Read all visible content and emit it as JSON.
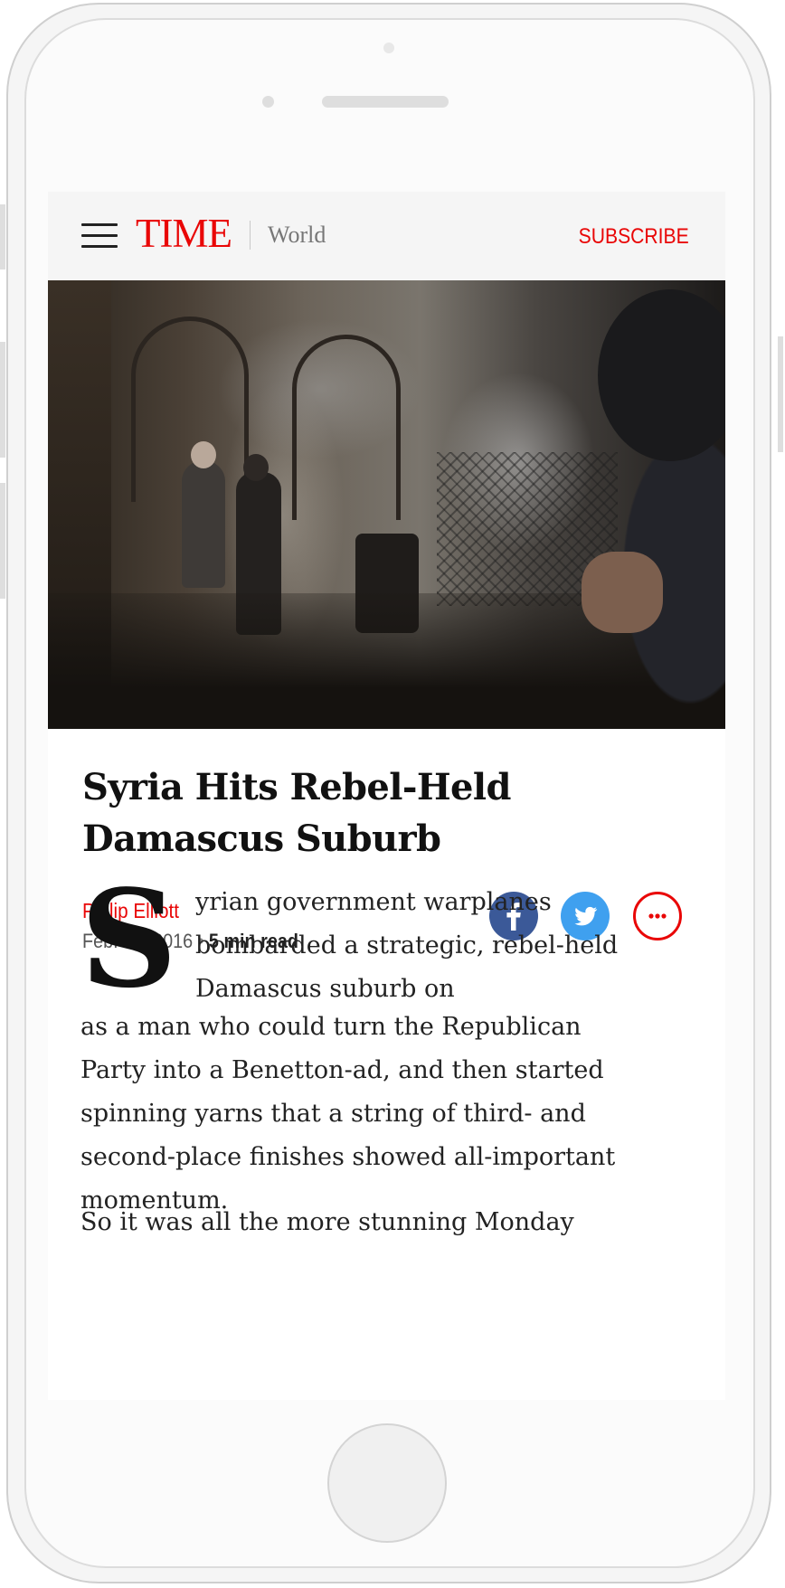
{
  "header": {
    "logo": "TIME",
    "section": "World",
    "subscribe_label": "SUBSCRIBE",
    "menu_icon": "hamburger-menu-icon"
  },
  "hero_image": {
    "description_icon": "war-photo"
  },
  "article": {
    "title_line1": "Syria Hits Rebel-Held",
    "title_line2": "Damascus Suburb",
    "author": "Philip Elliott",
    "date": "Feb. 21, 2016",
    "separator": "•",
    "read_time": "5 min read",
    "drop_cap": "S",
    "lead_lines": [
      "yrian government warplanes",
      "bombarded a strategic, rebel-held",
      "Damascus suburb on"
    ],
    "body_lines": [
      "as a man who could turn the Republican",
      "Party into a Benetton-ad, and then started",
      "spinning yarns that a string of third- and",
      "second-place finishes showed all-important",
      "momentum."
    ],
    "para2": "So it was all the more stunning Monday"
  },
  "share": {
    "facebook_icon": "facebook-icon",
    "twitter_icon": "twitter-icon",
    "more_icon": "more-options-icon"
  },
  "colors": {
    "brand_red": "#e90606",
    "facebook_blue": "#3b5998",
    "twitter_blue": "#3fa0ef"
  }
}
